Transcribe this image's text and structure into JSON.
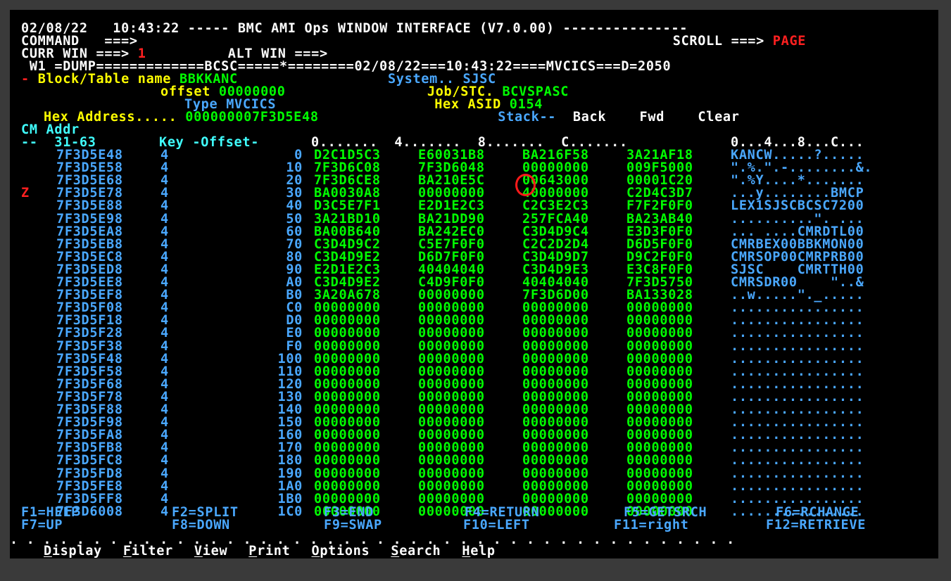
{
  "header": {
    "date": "02/08/22",
    "time": "10:43:22",
    "title_line": "----- BMC AMI Ops WINDOW INTERFACE (V7.0.00) ---------------",
    "command_label": "COMMAND   ===>",
    "command_value": "",
    "scroll_label": "SCROLL ===>",
    "scroll_value": "PAGE",
    "curr_win_label": "CURR WIN ===>",
    "curr_win_value": "1",
    "alt_win_label": "ALT WIN ===>",
    "alt_win_value": "",
    "window_line": " W1 =DUMP=============BCSC=====*========02/08/22===10:43:22====MVCICS===D=2050"
  },
  "info": {
    "block_marker": "-",
    "block_label": "Block/Table name",
    "block_value": "BBKKANC",
    "system_label": "System..",
    "system_value": "SJSC",
    "offset_label": "offset",
    "offset_value": "00000000",
    "job_label": "Job/STC.",
    "job_value": "BCVSPASC",
    "type_label": "Type",
    "type_value": "MVCICS",
    "asid_label": "Hex ASID",
    "asid_value": "0154",
    "hexaddr_label": "Hex Address.....",
    "hexaddr_value": "000000007F3D5E48",
    "stack_label": "Stack--",
    "back_label": "Back",
    "fwd_label": "Fwd",
    "clear_label": "Clear"
  },
  "columns": {
    "line1": "CM Addr",
    "line2_a": "--  31-63",
    "line2_b": "Key -Offset-",
    "line2_c": "0.......  4.......  8.......  C.......",
    "line2_d": "0...4...8...C..."
  },
  "rows": [
    {
      "cm": "",
      "addr": "7F3D5E48",
      "key": "4",
      "off": "0",
      "w1": "D2C1D5C3",
      "w2": "E60031B8",
      "w3": "BA216F58",
      "w4": "3A21AF18",
      "ascii": "KANCW.....?....."
    },
    {
      "cm": "",
      "addr": "7F3D5E58",
      "key": "4",
      "off": "10",
      "w1": "7F3D6C08",
      "w2": "7F3D6048",
      "w3": "00000000",
      "w4": "009F5000",
      "ascii": "\".%.\".-........&."
    },
    {
      "cm": "",
      "addr": "7F3D5E68",
      "key": "4",
      "off": "20",
      "w1": "7F3D6CE8",
      "w2": "BA210E5C",
      "w3": "00643000",
      "w4": "00001C20",
      "ascii": "\".%Y....*......."
    },
    {
      "cm": "Z",
      "addr": "7F3D5E78",
      "key": "4",
      "off": "30",
      "w1": "BA0030A8",
      "w2": "00000000",
      "w3": "40000000",
      "w4": "C2D4C3D7",
      "ascii": "...y........BMCP"
    },
    {
      "cm": "",
      "addr": "7F3D5E88",
      "key": "4",
      "off": "40",
      "w1": "D3C5E7F1",
      "w2": "E2D1E2C3",
      "w3": "C2C3E2C3",
      "w4": "F7F2F0F0",
      "ascii": "LEX1SJSCBCSC7200"
    },
    {
      "cm": "",
      "addr": "7F3D5E98",
      "key": "4",
      "off": "50",
      "w1": "3A21BD10",
      "w2": "BA21DD90",
      "w3": "257FCA40",
      "w4": "BA23AB40",
      "ascii": "..........\". ..."
    },
    {
      "cm": "",
      "addr": "7F3D5EA8",
      "key": "4",
      "off": "60",
      "w1": "BA00B640",
      "w2": "BA242EC0",
      "w3": "C3D4D9C4",
      "w4": "E3D3F0F0",
      "ascii": "... ....CMRDTL00"
    },
    {
      "cm": "",
      "addr": "7F3D5EB8",
      "key": "4",
      "off": "70",
      "w1": "C3D4D9C2",
      "w2": "C5E7F0F0",
      "w3": "C2C2D2D4",
      "w4": "D6D5F0F0",
      "ascii": "CMRBEX00BBKMON00"
    },
    {
      "cm": "",
      "addr": "7F3D5EC8",
      "key": "4",
      "off": "80",
      "w1": "C3D4D9E2",
      "w2": "D6D7F0F0",
      "w3": "C3D4D9D7",
      "w4": "D9C2F0F0",
      "ascii": "CMRSOP00CMRPRB00"
    },
    {
      "cm": "",
      "addr": "7F3D5ED8",
      "key": "4",
      "off": "90",
      "w1": "E2D1E2C3",
      "w2": "40404040",
      "w3": "C3D4D9E3",
      "w4": "E3C8F0F0",
      "ascii": "SJSC    CMRTTH00"
    },
    {
      "cm": "",
      "addr": "7F3D5EE8",
      "key": "4",
      "off": "A0",
      "w1": "C3D4D9E2",
      "w2": "C4D9F0F0",
      "w3": "40404040",
      "w4": "7F3D5750",
      "ascii": "CMRSDR00    \"..&"
    },
    {
      "cm": "",
      "addr": "7F3D5EF8",
      "key": "4",
      "off": "B0",
      "w1": "3A20A678",
      "w2": "00000000",
      "w3": "7F3D6D00",
      "w4": "BA133028",
      "ascii": "..w.....\"._....."
    },
    {
      "cm": "",
      "addr": "7F3D5F08",
      "key": "4",
      "off": "C0",
      "w1": "00000000",
      "w2": "00000000",
      "w3": "00000000",
      "w4": "00000000",
      "ascii": "................"
    },
    {
      "cm": "",
      "addr": "7F3D5F18",
      "key": "4",
      "off": "D0",
      "w1": "00000000",
      "w2": "00000000",
      "w3": "00000000",
      "w4": "00000000",
      "ascii": "................"
    },
    {
      "cm": "",
      "addr": "7F3D5F28",
      "key": "4",
      "off": "E0",
      "w1": "00000000",
      "w2": "00000000",
      "w3": "00000000",
      "w4": "00000000",
      "ascii": "................"
    },
    {
      "cm": "",
      "addr": "7F3D5F38",
      "key": "4",
      "off": "F0",
      "w1": "00000000",
      "w2": "00000000",
      "w3": "00000000",
      "w4": "00000000",
      "ascii": "................"
    },
    {
      "cm": "",
      "addr": "7F3D5F48",
      "key": "4",
      "off": "100",
      "w1": "00000000",
      "w2": "00000000",
      "w3": "00000000",
      "w4": "00000000",
      "ascii": "................"
    },
    {
      "cm": "",
      "addr": "7F3D5F58",
      "key": "4",
      "off": "110",
      "w1": "00000000",
      "w2": "00000000",
      "w3": "00000000",
      "w4": "00000000",
      "ascii": "................"
    },
    {
      "cm": "",
      "addr": "7F3D5F68",
      "key": "4",
      "off": "120",
      "w1": "00000000",
      "w2": "00000000",
      "w3": "00000000",
      "w4": "00000000",
      "ascii": "................"
    },
    {
      "cm": "",
      "addr": "7F3D5F78",
      "key": "4",
      "off": "130",
      "w1": "00000000",
      "w2": "00000000",
      "w3": "00000000",
      "w4": "00000000",
      "ascii": "................"
    },
    {
      "cm": "",
      "addr": "7F3D5F88",
      "key": "4",
      "off": "140",
      "w1": "00000000",
      "w2": "00000000",
      "w3": "00000000",
      "w4": "00000000",
      "ascii": "................"
    },
    {
      "cm": "",
      "addr": "7F3D5F98",
      "key": "4",
      "off": "150",
      "w1": "00000000",
      "w2": "00000000",
      "w3": "00000000",
      "w4": "00000000",
      "ascii": "................"
    },
    {
      "cm": "",
      "addr": "7F3D5FA8",
      "key": "4",
      "off": "160",
      "w1": "00000000",
      "w2": "00000000",
      "w3": "00000000",
      "w4": "00000000",
      "ascii": "................"
    },
    {
      "cm": "",
      "addr": "7F3D5FB8",
      "key": "4",
      "off": "170",
      "w1": "00000000",
      "w2": "00000000",
      "w3": "00000000",
      "w4": "00000000",
      "ascii": "................"
    },
    {
      "cm": "",
      "addr": "7F3D5FC8",
      "key": "4",
      "off": "180",
      "w1": "00000000",
      "w2": "00000000",
      "w3": "00000000",
      "w4": "00000000",
      "ascii": "................"
    },
    {
      "cm": "",
      "addr": "7F3D5FD8",
      "key": "4",
      "off": "190",
      "w1": "00000000",
      "w2": "00000000",
      "w3": "00000000",
      "w4": "00000000",
      "ascii": "................"
    },
    {
      "cm": "",
      "addr": "7F3D5FE8",
      "key": "4",
      "off": "1A0",
      "w1": "00000000",
      "w2": "00000000",
      "w3": "00000000",
      "w4": "00000000",
      "ascii": "................"
    },
    {
      "cm": "",
      "addr": "7F3D5FF8",
      "key": "4",
      "off": "1B0",
      "w1": "00000000",
      "w2": "00000000",
      "w3": "00000000",
      "w4": "00000000",
      "ascii": "................"
    },
    {
      "cm": "",
      "addr": "7F3D6008",
      "key": "4",
      "off": "1C0",
      "w1": "00000000",
      "w2": "00000000",
      "w3": "00000000",
      "w4": "00000000",
      "ascii": "................"
    }
  ],
  "fkeys_row1": [
    "F1=HELP",
    "F2=SPLIT",
    "F3=END",
    "F4=RETURN",
    "F5=GETSRCH",
    "F6=RCHANGE"
  ],
  "fkeys_row2": [
    "F7=UP",
    "F8=DOWN",
    "F9=SWAP",
    "F10=LEFT",
    "F11=right",
    "F12=RETRIEVE"
  ],
  "menu_dots": ". . . . . . . . . . . . . . . . . . . . . . . . . . . . . . . . . . . . . . . . . . . .",
  "menu": [
    {
      "key": "D",
      "rest": "isplay"
    },
    {
      "key": "F",
      "rest": "ilter"
    },
    {
      "key": "V",
      "rest": "iew"
    },
    {
      "key": "P",
      "rest": "rint"
    },
    {
      "key": "O",
      "rest": "ptions"
    },
    {
      "key": "S",
      "rest": "earch"
    },
    {
      "key": "H",
      "rest": "elp"
    }
  ],
  "colors": {
    "background": "#000000",
    "hex_data": "#00ff00",
    "labels": "#ffff00",
    "address": "#4aa8ff",
    "highlight": "#ff2020",
    "circle_annotation": "#ff1a1a"
  }
}
